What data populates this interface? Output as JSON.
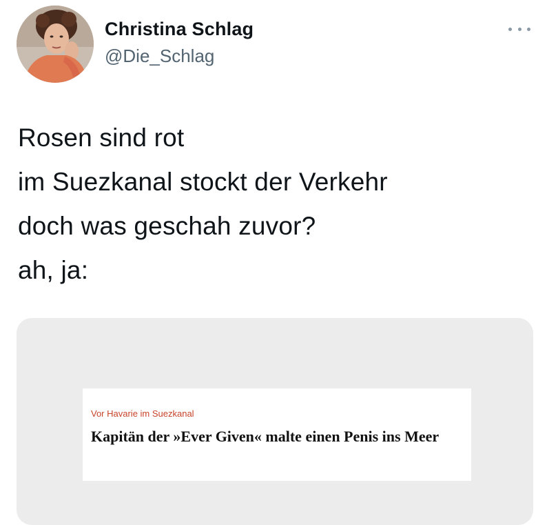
{
  "author": {
    "display_name": "Christina Schlag",
    "handle": "@Die_Schlag"
  },
  "tweet": {
    "lines": [
      "Rosen sind rot",
      "im Suezkanal stockt der Verkehr",
      "doch was geschah zuvor?",
      "ah, ja:"
    ]
  },
  "media": {
    "article": {
      "kicker": "Vor Havarie im Suezkanal",
      "headline": "Kapitän der »Ever Given« malte einen Penis ins Meer"
    }
  },
  "icons": {
    "more": "more-horizontal-icon"
  },
  "colors": {
    "handle": "#536471",
    "text": "#0f1419",
    "kicker": "#c7442a",
    "media_bg": "#ececec"
  }
}
